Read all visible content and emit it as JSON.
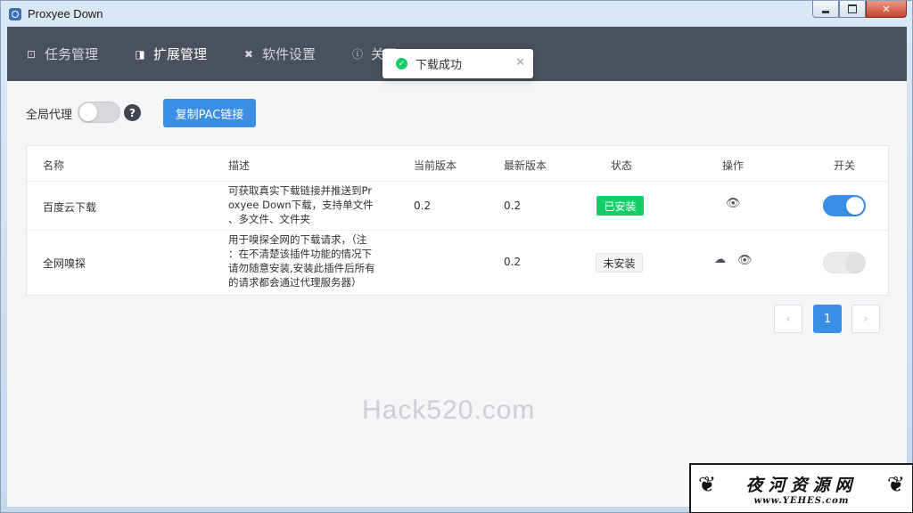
{
  "window": {
    "title": "Proxyee Down"
  },
  "nav": {
    "items": [
      {
        "label": "任务管理",
        "icon": "download-box-icon"
      },
      {
        "label": "扩展管理",
        "icon": "extension-icon"
      },
      {
        "label": "软件设置",
        "icon": "tools-icon"
      },
      {
        "label": "关于",
        "icon": "info-icon"
      }
    ],
    "active_index": 1
  },
  "toast": {
    "message": "下载成功"
  },
  "toolbar": {
    "proxy_label": "全局代理",
    "proxy_enabled": false,
    "help": "?",
    "pac_button": "复制PAC链接"
  },
  "table": {
    "headers": [
      "名称",
      "描述",
      "当前版本",
      "最新版本",
      "状态",
      "操作",
      "开关"
    ],
    "rows": [
      {
        "name": "百度云下载",
        "desc_lines": [
          "可获取真实下载链接并推送到Pr",
          "oxyee Down下载，支持单文件",
          "、多文件、文件夹"
        ],
        "current_version": "0.2",
        "latest_version": "0.2",
        "status": "已安装",
        "enabled": true
      },
      {
        "name": "全网嗅探",
        "desc_lines": [
          "用于嗅探全网的下载请求，（注",
          "：在不清楚该插件功能的情况下",
          "请勿随意安装,安装此插件后所有",
          "的请求都会通过代理服务器）"
        ],
        "current_version": "",
        "latest_version": "0.2",
        "status": "未安装",
        "enabled": false
      }
    ]
  },
  "pagination": {
    "prev": "‹",
    "current": "1",
    "next": "›"
  },
  "watermark": "Hack520.com",
  "corner_logo": {
    "cn": "夜河资源网",
    "url": "www.YEHES.com"
  },
  "colors": {
    "primary": "#3a8ee6",
    "success": "#13ce66",
    "navbar": "#4a505d"
  }
}
